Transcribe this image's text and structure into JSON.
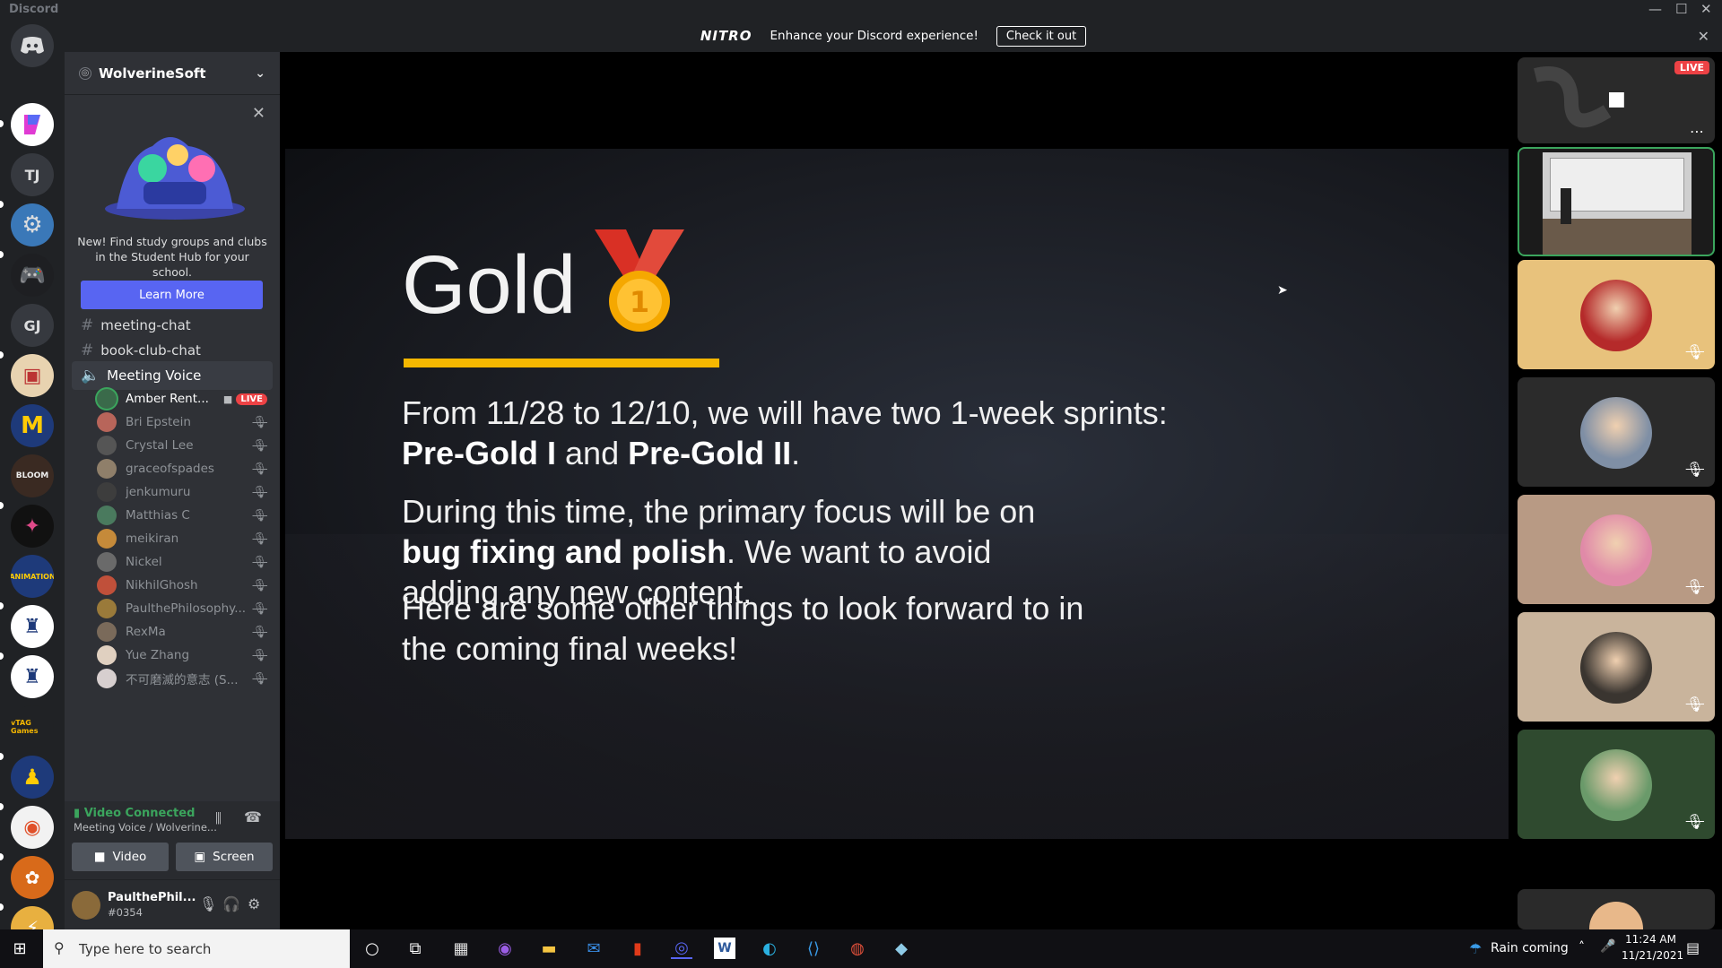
{
  "window": {
    "app_name": "Discord"
  },
  "nitro": {
    "logo": "NITRO",
    "message": "Enhance your Discord experience!",
    "cta": "Check it out"
  },
  "servers": [
    "TJ",
    "GJ"
  ],
  "server_labels": {
    "bloom": "BLOOM",
    "animation": "ANIMATION",
    "tag": "vTAG Games"
  },
  "guild": {
    "name": "WolverineSoft"
  },
  "promo": {
    "text": "New! Find study groups and clubs in the Student Hub for your school.",
    "button": "Learn More"
  },
  "channels": [
    {
      "name": "meeting-chat",
      "type": "text"
    },
    {
      "name": "book-club-chat",
      "type": "text"
    },
    {
      "name": "Meeting Voice",
      "type": "voice"
    }
  ],
  "voice_users": [
    {
      "name": "Amber Rent...",
      "live": "LIVE",
      "color": "#3a6a4a"
    },
    {
      "name": "Bri Epstein",
      "color": "#b8655a"
    },
    {
      "name": "Crystal Lee",
      "color": "#555"
    },
    {
      "name": "graceofspades",
      "color": "#8f7f6a"
    },
    {
      "name": "jenkumuru",
      "color": "#3d3d3d"
    },
    {
      "name": "Matthias C",
      "color": "#4a7a5e"
    },
    {
      "name": "meikiran",
      "color": "#c58a3a"
    },
    {
      "name": "Nickel",
      "color": "#6a6a6a"
    },
    {
      "name": "NikhilGhosh",
      "color": "#c0503a"
    },
    {
      "name": "PaulthePhilosophy...",
      "color": "#9a7a3a"
    },
    {
      "name": "RexMa",
      "color": "#7a6a5a"
    },
    {
      "name": "Yue Zhang",
      "color": "#e0d0c0"
    },
    {
      "name": "不可磨滅的意志 (S...",
      "color": "#d7cfcf"
    }
  ],
  "voice_connection": {
    "status": "Video Connected",
    "channel": "Meeting Voice / Wolverine...",
    "video_button": "Video",
    "screen_button": "Screen"
  },
  "user": {
    "name": "PaulthePhil...",
    "tag": "#0354"
  },
  "stream_badge": "LIVE",
  "slide": {
    "title": "Gold",
    "p1_a": "From 11/28 to 12/10, we will have two 1-week sprints: ",
    "p1_b": "Pre-Gold I",
    "p1_c": " and ",
    "p1_d": "Pre-Gold II",
    "p1_e": ".",
    "p2_a": "During this time, the primary focus will be on ",
    "p2_b": "bug fixing and polish",
    "p2_c": ". We want to avoid adding any new content.",
    "p3": "Here are some other things to look forward to in the coming final weeks!"
  },
  "tiles": [
    {
      "bg": "#2a2a2a",
      "face": ""
    },
    {
      "bg": "#e8c27c",
      "face": "#b52a2a"
    },
    {
      "bg": "#2b2b2b",
      "face": "#7f8fa5"
    },
    {
      "bg": "#b89a84",
      "face": "#e08aa8"
    },
    {
      "bg": "#c9b49c",
      "face": "#3a3530"
    },
    {
      "bg": "#2f4a2f",
      "face": "#6a9a6a"
    }
  ],
  "taskbar": {
    "search_placeholder": "Type here to search",
    "weather": "Rain coming",
    "time": "11:24 AM",
    "date": "11/21/2021"
  }
}
